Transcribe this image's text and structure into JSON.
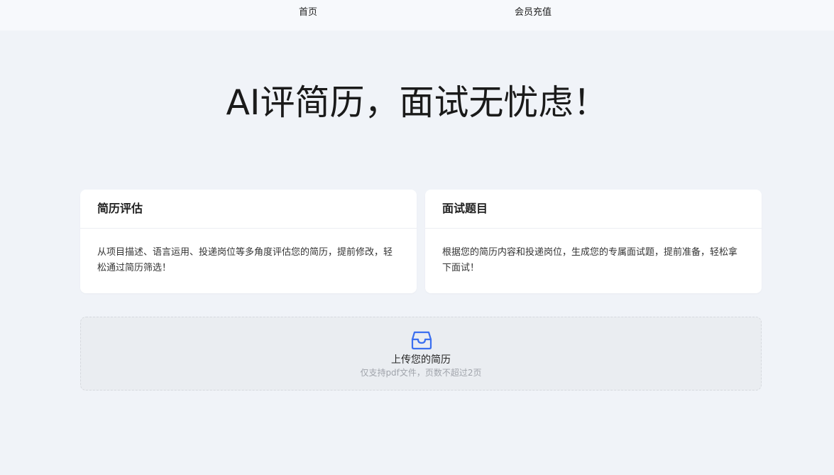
{
  "nav": {
    "home": "首页",
    "recharge": "会员充值"
  },
  "hero": {
    "title": "AI评简历，面试无忧虑！"
  },
  "cards": [
    {
      "title": "简历评估",
      "description": "从项目描述、语言运用、投递岗位等多角度评估您的简历，提前修改，轻松通过简历筛选！"
    },
    {
      "title": "面试题目",
      "description": "根据您的简历内容和投递岗位，生成您的专属面试题，提前准备，轻松拿下面试！"
    }
  ],
  "upload": {
    "icon": "inbox-icon",
    "title": "上传您的简历",
    "hint": "仅支持pdf文件，页数不超过2页",
    "accent_color": "#3b6ff0"
  }
}
